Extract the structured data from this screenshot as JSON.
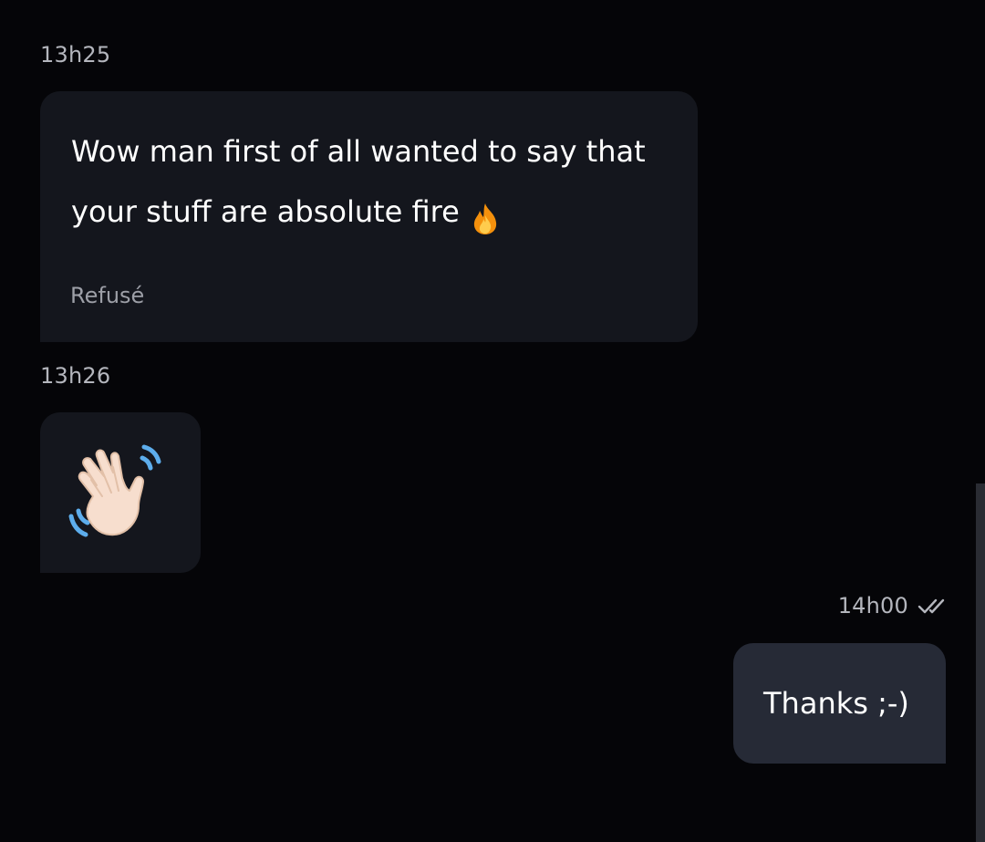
{
  "messages": [
    {
      "time": "13h25",
      "text_line1": "Wow man first of all wanted to say that",
      "text_line2": "your stuff are absolute fire",
      "text_emoji": "fire-emoji",
      "status": "Refusé"
    },
    {
      "time": "13h26",
      "emoji": "waving-hand-emoji"
    },
    {
      "time": "14h00",
      "receipt_icon": "double-check-icon",
      "text": "Thanks ;-)"
    }
  ],
  "colors": {
    "background": "#050508",
    "incoming_bubble": "#14161d",
    "outgoing_bubble": "#262a36",
    "timestamp": "#b4b6bd",
    "scrollbar": "#2a2c33"
  }
}
